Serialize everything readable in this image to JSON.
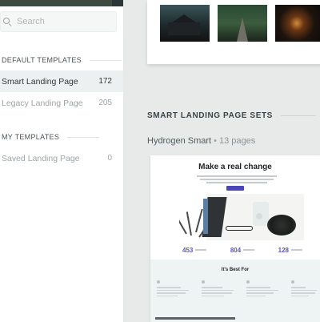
{
  "search": {
    "placeholder": "Search"
  },
  "sidebar": {
    "sections": [
      {
        "heading": "DEFAULT TEMPLATES",
        "items": [
          {
            "label": "Smart Landing Page",
            "count": "172",
            "selected": true
          },
          {
            "label": "Legacy Landing Page",
            "count": "205",
            "selected": false
          }
        ]
      },
      {
        "heading": "MY TEMPLATES",
        "items": [
          {
            "label": "Saved Landing Page",
            "count": "0",
            "selected": false
          }
        ]
      }
    ]
  },
  "main": {
    "sets_heading": "SMART LANDING PAGE SETS",
    "set": {
      "name": "Hydrogen Smart",
      "separator": "•",
      "pages": "13 pages",
      "preview": {
        "title": "Make a real change",
        "stats": [
          "453",
          "804",
          "128"
        ],
        "best_for_title": "It's Best For"
      }
    }
  },
  "colors": {
    "selected_bg": "#edf0f0",
    "main_bg": "#e8eaea",
    "accent": "#5b56c2"
  }
}
